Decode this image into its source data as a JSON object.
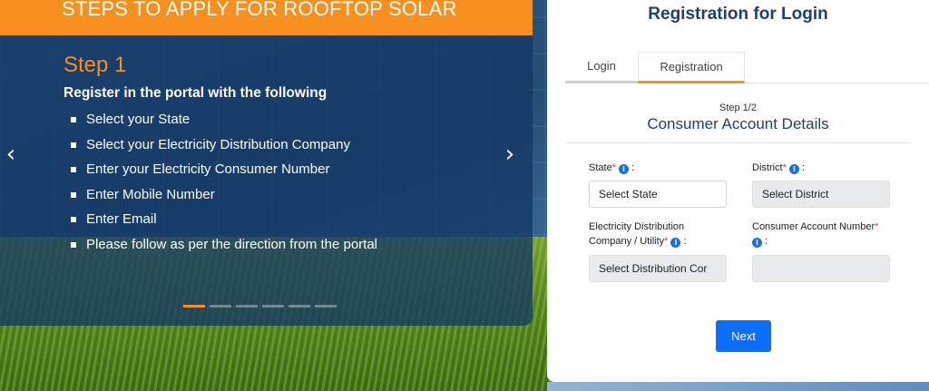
{
  "carousel": {
    "header_title": "STEPS TO APPLY FOR ROOFTOP SOLAR",
    "step_title": "Step 1",
    "intro": "Register in the portal with the following",
    "items": [
      "Select your State",
      "Select your Electricity Distribution Company",
      "Enter your Electricity Consumer Number",
      "Enter Mobile Number",
      "Enter Email",
      "Please follow as per the direction from the portal"
    ],
    "prev_arrow": "‹",
    "next_arrow": "›",
    "slide_count": 6,
    "active_slide": 1,
    "accent_color": "#f7901e"
  },
  "panel": {
    "title": "Registration for Login",
    "tabs": {
      "login": "Login",
      "registration": "Registration",
      "active": "Registration"
    },
    "step_count": "Step 1/2",
    "section_title": "Consumer Account Details",
    "fields": {
      "state": {
        "label": "State",
        "required": "*",
        "suffix": " :",
        "value": "Select State"
      },
      "district": {
        "label": "District",
        "required": "*",
        "suffix": " :",
        "value": "Select District"
      },
      "utility": {
        "label_line1": "Electricity Distribution",
        "label_line2": "Company / Utility",
        "required": "*",
        "suffix": " :",
        "value": "Select Distribution Cor"
      },
      "consumer_account": {
        "label": "Consumer Account Number",
        "required": "*",
        "suffix": " :",
        "value": ""
      }
    },
    "info_icon": "i",
    "next_label": "Next",
    "button_color": "#0d6efd"
  }
}
